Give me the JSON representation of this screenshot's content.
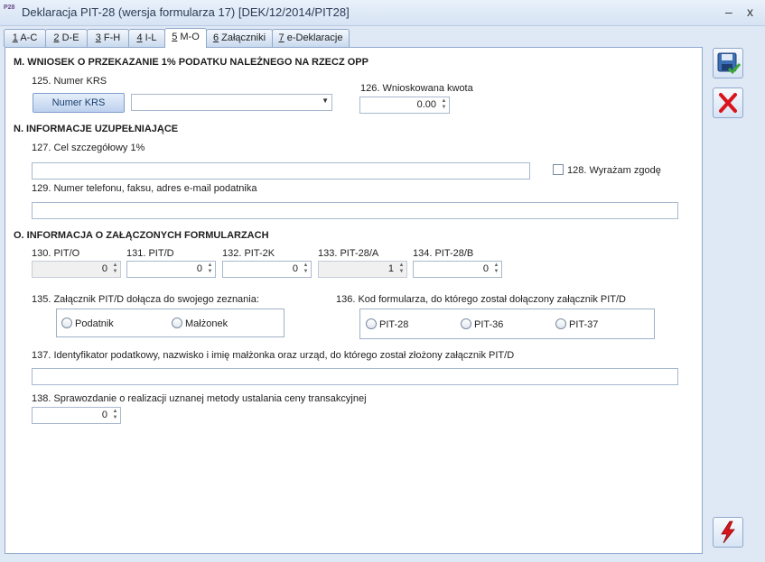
{
  "window": {
    "title": "Deklaracja PIT-28 (wersja formularza 17) [DEK/12/2014/PIT28]",
    "app_icon": "P28",
    "minimize_glyph": "–",
    "close_glyph": "x"
  },
  "tabs": [
    {
      "key": "1",
      "label": "A-C"
    },
    {
      "key": "2",
      "label": "D-E"
    },
    {
      "key": "3",
      "label": "F-H"
    },
    {
      "key": "4",
      "label": "I-L"
    },
    {
      "key": "5",
      "label": "M-O",
      "active": true
    },
    {
      "key": "6",
      "label": "Załączniki"
    },
    {
      "key": "7",
      "label": "e-Deklaracje"
    }
  ],
  "section_m": {
    "title": "M. WNIOSEK O PRZEKAZANIE 1% PODATKU NALEŻNEGO NA RZECZ OPP",
    "krs_label": "125. Numer KRS",
    "krs_button": "Numer KRS",
    "krs_value": "",
    "amount_label": "126. Wnioskowana kwota",
    "amount_value": "0.00"
  },
  "section_n": {
    "title": "N. INFORMACJE UZUPEŁNIAJĄCE",
    "goal_label": "127. Cel szczegółowy 1%",
    "goal_value": "",
    "consent_label": "128. Wyrażam zgodę",
    "consent_checked": false,
    "contact_label": "129. Numer telefonu, faksu, adres e-mail podatnika",
    "contact_value": ""
  },
  "section_o": {
    "title": "O. INFORMACJA O ZAŁĄCZONYCH FORMULARZACH",
    "counts": [
      {
        "label": "130. PIT/O",
        "value": "0",
        "enabled": false
      },
      {
        "label": "131. PIT/D",
        "value": "0",
        "enabled": true
      },
      {
        "label": "132. PIT-2K",
        "value": "0",
        "enabled": true
      },
      {
        "label": "133. PIT-28/A",
        "value": "1",
        "enabled": false
      },
      {
        "label": "134. PIT-28/B",
        "value": "0",
        "enabled": true
      }
    ],
    "attach_label": "135. Załącznik PIT/D dołącza do swojego zeznania:",
    "attach_options": [
      "Podatnik",
      "Małżonek"
    ],
    "form_code_label": "136. Kod formularza, do którego został dołączony załącznik PIT/D",
    "form_code_options": [
      "PIT-28",
      "PIT-36",
      "PIT-37"
    ],
    "spouse_label": "137. Identyfikator podatkowy, nazwisko i imię małżonka oraz urząd, do którego został złożony załącznik PIT/D",
    "spouse_value": "",
    "report_label": "138. Sprawozdanie o realizacji uznanej metody ustalania ceny transakcyjnej",
    "report_value": "0"
  },
  "icons": {
    "save": "save-disk-icon",
    "cancel": "red-x-icon",
    "action": "lightning-icon"
  },
  "colors": {
    "accent": "#2b5797",
    "cancel_red": "#d9141a",
    "check_green": "#3aa935"
  }
}
